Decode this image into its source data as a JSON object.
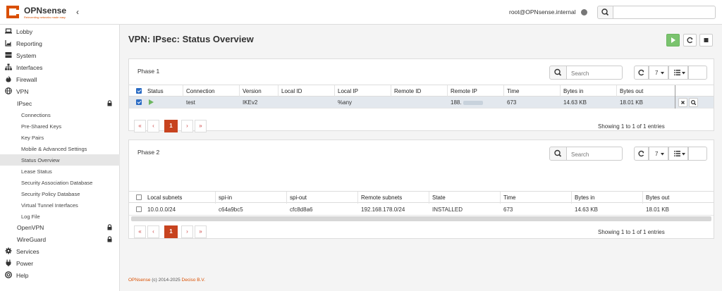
{
  "brand": {
    "name": "OPNsense",
    "tagline": "Reinventing networks made easy",
    "accent": "#d94f00"
  },
  "header": {
    "user": "root@OPNsense.internal",
    "search_value": ""
  },
  "sidebar": {
    "items": [
      {
        "label": "Lobby",
        "icon": "laptop-icon"
      },
      {
        "label": "Reporting",
        "icon": "area-chart-icon"
      },
      {
        "label": "System",
        "icon": "server-icon"
      },
      {
        "label": "Interfaces",
        "icon": "sitemap-icon"
      },
      {
        "label": "Firewall",
        "icon": "fire-icon"
      },
      {
        "label": "VPN",
        "icon": "globe-icon"
      }
    ],
    "vpn_sub": [
      {
        "label": "IPsec"
      },
      {
        "label": "OpenVPN"
      },
      {
        "label": "WireGuard"
      }
    ],
    "ipsec_leaves": [
      "Connections",
      "Pre-Shared Keys",
      "Key Pairs",
      "Mobile & Advanced Settings",
      "Status Overview",
      "Lease Status",
      "Security Association Database",
      "Security Policy Database",
      "Virtual Tunnel Interfaces",
      "Log File"
    ],
    "bottom_items": [
      {
        "label": "Services",
        "icon": "cog-icon"
      },
      {
        "label": "Power",
        "icon": "plug-icon"
      },
      {
        "label": "Help",
        "icon": "life-ring-icon"
      }
    ]
  },
  "page": {
    "title": "VPN: IPsec: Status Overview"
  },
  "phase1": {
    "title": "Phase 1",
    "search_placeholder": "Search",
    "page_size": "7",
    "columns": [
      "Status",
      "Connection",
      "Version",
      "Local ID",
      "Local IP",
      "Remote ID",
      "Remote IP",
      "Time",
      "Bytes in",
      "Bytes out"
    ],
    "row": {
      "selected": true,
      "status": "running",
      "connection": "test",
      "version": "IKEv2",
      "local_id": "",
      "local_ip": "%any",
      "remote_id": "",
      "remote_ip": "188.",
      "time": "673",
      "bytes_in": "14.63 KB",
      "bytes_out": "18.01 KB"
    },
    "pager": {
      "current": "1",
      "first": "«",
      "prev": "‹",
      "next": "›",
      "last": "»"
    },
    "showing": "Showing 1 to 1 of 1 entries"
  },
  "phase2": {
    "title": "Phase 2",
    "search_placeholder": "Search",
    "page_size": "7",
    "columns": [
      "Local subnets",
      "spi-in",
      "spi-out",
      "Remote subnets",
      "State",
      "Time",
      "Bytes in",
      "Bytes out"
    ],
    "row": {
      "selected": false,
      "local_subnets": "10.0.0.0/24",
      "spi_in": "c64a9bc5",
      "spi_out": "cfc8d8a6",
      "remote_subnets": "192.168.178.0/24",
      "state": "INSTALLED",
      "time": "673",
      "bytes_in": "14.63 KB",
      "bytes_out": "18.01 KB"
    },
    "pager": {
      "current": "1",
      "first": "«",
      "prev": "‹",
      "next": "›",
      "last": "»"
    },
    "showing": "Showing 1 to 1 of 1 entries"
  },
  "footer": {
    "brand": "OPNsense",
    "copyright": "(c) 2014-2025",
    "company": "Deciso B.V."
  }
}
